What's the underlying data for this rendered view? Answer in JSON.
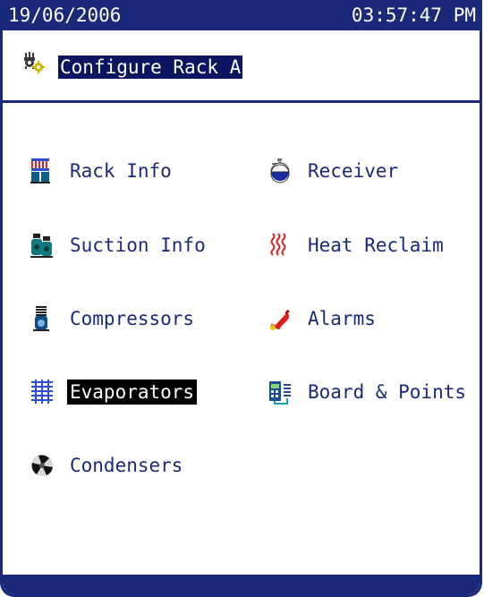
{
  "status_bar": {
    "date": "19/06/2006",
    "time": "03:57:47 PM"
  },
  "header": {
    "title": "Configure Rack A",
    "icon": "gear-icon"
  },
  "menu": {
    "left": [
      {
        "label": "Rack Info",
        "icon": "rack-icon"
      },
      {
        "label": "Suction Info",
        "icon": "suction-icon"
      },
      {
        "label": "Compressors",
        "icon": "compressor-icon"
      },
      {
        "label": "Evaporators",
        "icon": "evaporator-icon",
        "selected": true
      },
      {
        "label": "Condensers",
        "icon": "fan-icon"
      }
    ],
    "right": [
      {
        "label": "Receiver",
        "icon": "receiver-icon"
      },
      {
        "label": "Heat Reclaim",
        "icon": "heat-coil-icon"
      },
      {
        "label": "Alarms",
        "icon": "alarm-bell-icon"
      },
      {
        "label": "Board & Points",
        "icon": "board-icon"
      }
    ]
  },
  "colors": {
    "accent": "#1b2a78",
    "selection": "#000000",
    "title_highlight": "#0b1560"
  }
}
